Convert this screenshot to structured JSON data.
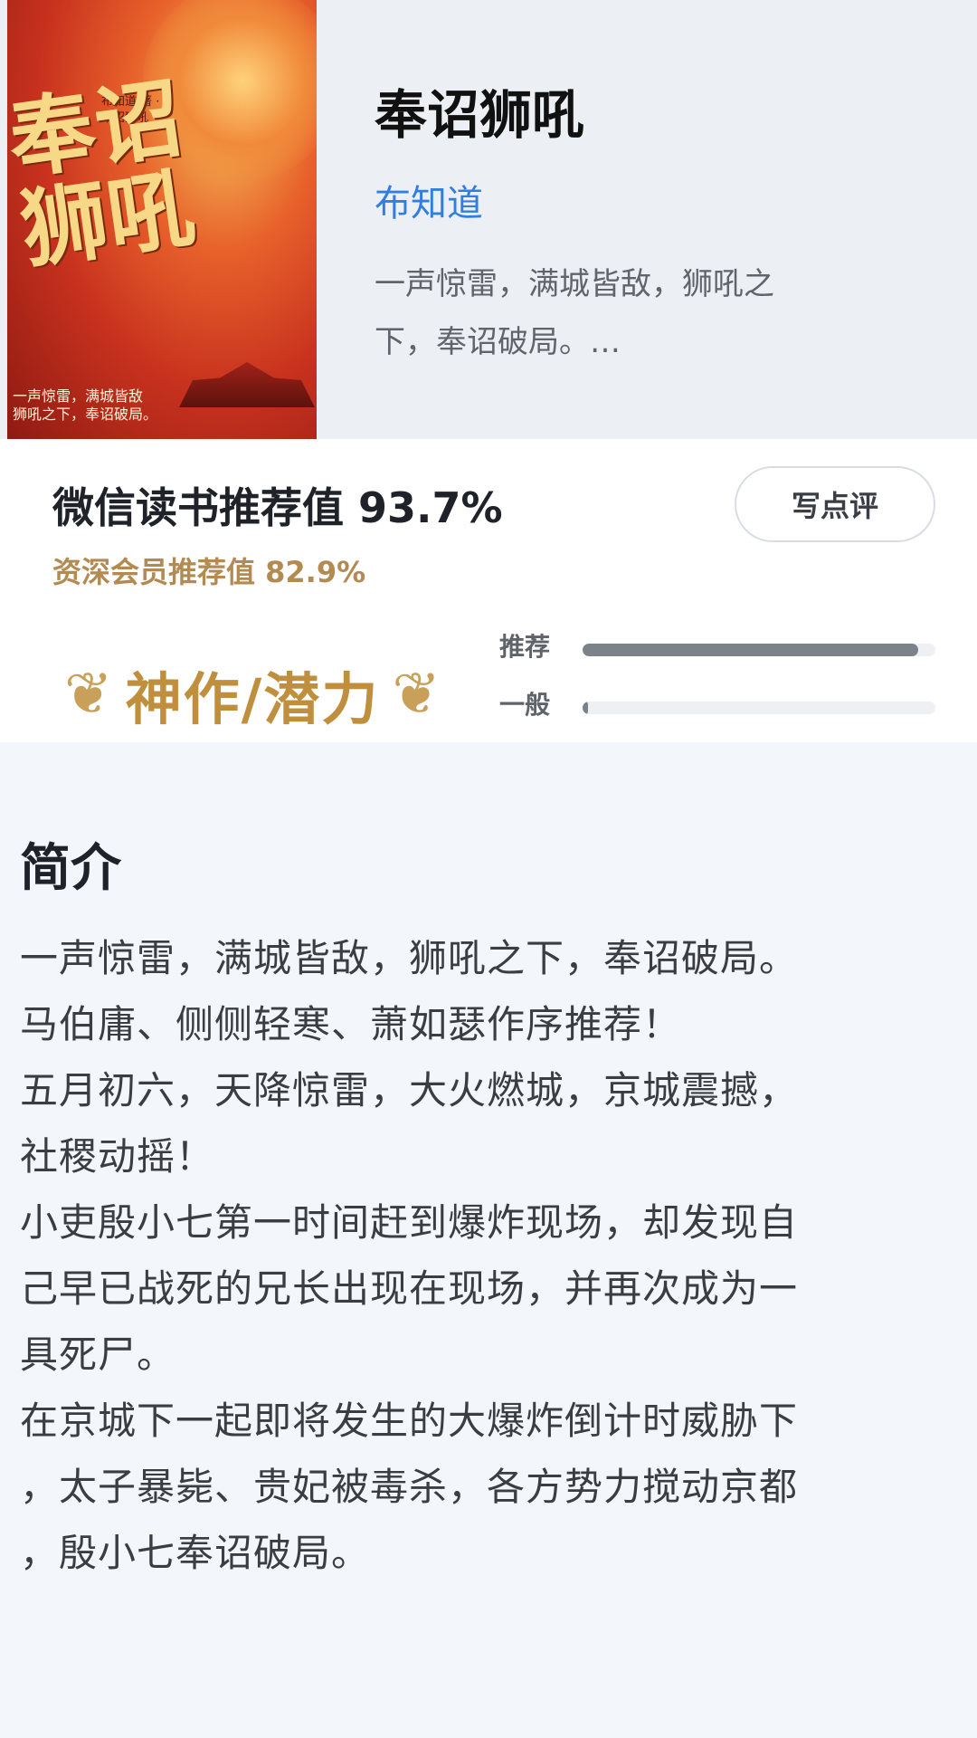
{
  "book": {
    "cover": {
      "title": "奉诏狮吼",
      "small_text": "布知道 著 · 奉诏狮吼 ·",
      "tagline_1": "一声惊雷，满城皆敌",
      "tagline_2": "狮吼之下，奉诏破局。"
    },
    "title": "奉诏狮吼",
    "author": "布知道",
    "blurb_1": "一声惊雷，满城皆敌，狮吼之",
    "blurb_2": "下，奉诏破局。…"
  },
  "rating": {
    "main_text": "微信读书推荐值 93.7%",
    "sub_text": "资深会员推荐值 82.9%",
    "write_review_label": "写点评",
    "badge_text": "神作/潜力",
    "bars": [
      {
        "label": "推荐",
        "fraction": 0.95
      },
      {
        "label": "一般",
        "fraction": 0.015
      }
    ]
  },
  "intro": {
    "title": "简介",
    "lines": [
      "一声惊雷，满城皆敌，狮吼之下，奉诏破局。",
      "马伯庸、侧侧轻寒、萧如瑟作序推荐！",
      "五月初六，天降惊雷，大火燃城，京城震撼，",
      "社稷动摇！",
      "小吏殷小七第一时间赶到爆炸现场，却发现自",
      "己早已战死的兄长出现在现场，并再次成为一",
      "具死尸。",
      "在京城下一起即将发生的大爆炸倒计时威胁下",
      "，太子暴毙、贵妃被毒杀，各方势力搅动京都",
      "，殷小七奉诏破局。"
    ]
  },
  "colors": {
    "author": "#2f7fe0",
    "gold": "#c08f3e",
    "bar_fill": "#7c828a"
  }
}
